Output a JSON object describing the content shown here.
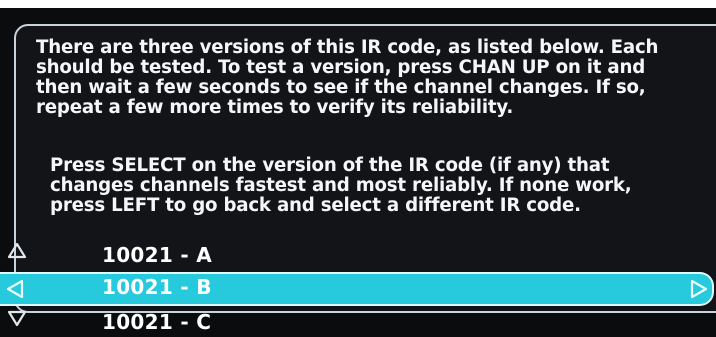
{
  "instructions": {
    "paragraph1": "There are three versions of this IR code, as listed below. Each\nshould be tested. To test a version, press CHAN UP on it and\nthen wait a few seconds to see if the channel changes. If so,\nrepeat a few more times to verify its reliability.",
    "paragraph2": "Press SELECT on the version of the IR code (if any) that\nchanges channels fastest and most reliably. If none work,\npress LEFT to go back and select a different IR code."
  },
  "versions": {
    "items": [
      {
        "label": "10021 - A"
      },
      {
        "label": "10021 - B",
        "selected": true
      },
      {
        "label": "10021 - C"
      }
    ]
  },
  "colors": {
    "background": "#0b0c0e",
    "panel_border": "#c9d3dc",
    "highlight": "#27c9dc",
    "text": "#ffffff"
  },
  "icons": [
    "up-arrow-icon",
    "left-arrow-icon",
    "right-arrow-icon",
    "down-arrow-icon"
  ]
}
